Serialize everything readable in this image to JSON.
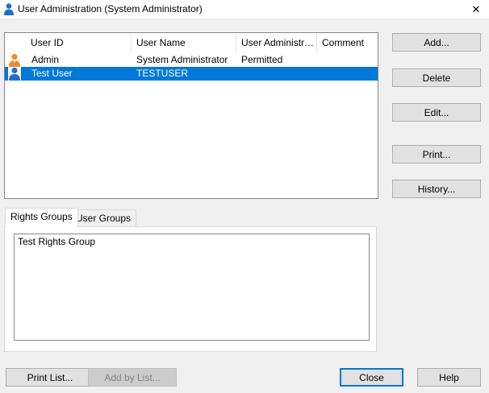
{
  "window": {
    "title": "User Administration (System Administrator)",
    "close_glyph": "✕",
    "icon": "user-icon"
  },
  "user_list": {
    "columns": [
      "User ID",
      "User Name",
      "User Administrati...",
      "Comment"
    ],
    "rows": [
      {
        "icon": "user-orange-icon",
        "user_id": "Admin",
        "user_name": "System Administrator",
        "user_admin": "Permitted",
        "comment": "",
        "selected": false
      },
      {
        "icon": "user-blue-icon",
        "user_id": "Test User",
        "user_name": "TESTUSER",
        "user_admin": "",
        "comment": "",
        "selected": true
      }
    ]
  },
  "side_buttons": {
    "add": "Add...",
    "delete": "Delete",
    "edit": "Edit...",
    "print": "Print...",
    "history": "History..."
  },
  "tabs": {
    "rights_groups": "Rights Groups",
    "user_groups": "User Groups",
    "active": "rights_groups"
  },
  "rights_groups": {
    "items": [
      "Test Rights Group"
    ]
  },
  "bottom_buttons": {
    "print_list": "Print List...",
    "add_by_list": "Add by List...",
    "close": "Close",
    "help": "Help"
  },
  "colors": {
    "selection": "#0078d7",
    "user_orange": "#f08a24",
    "user_blue": "#1e6fc9",
    "default_button_border": "#0078d7"
  }
}
